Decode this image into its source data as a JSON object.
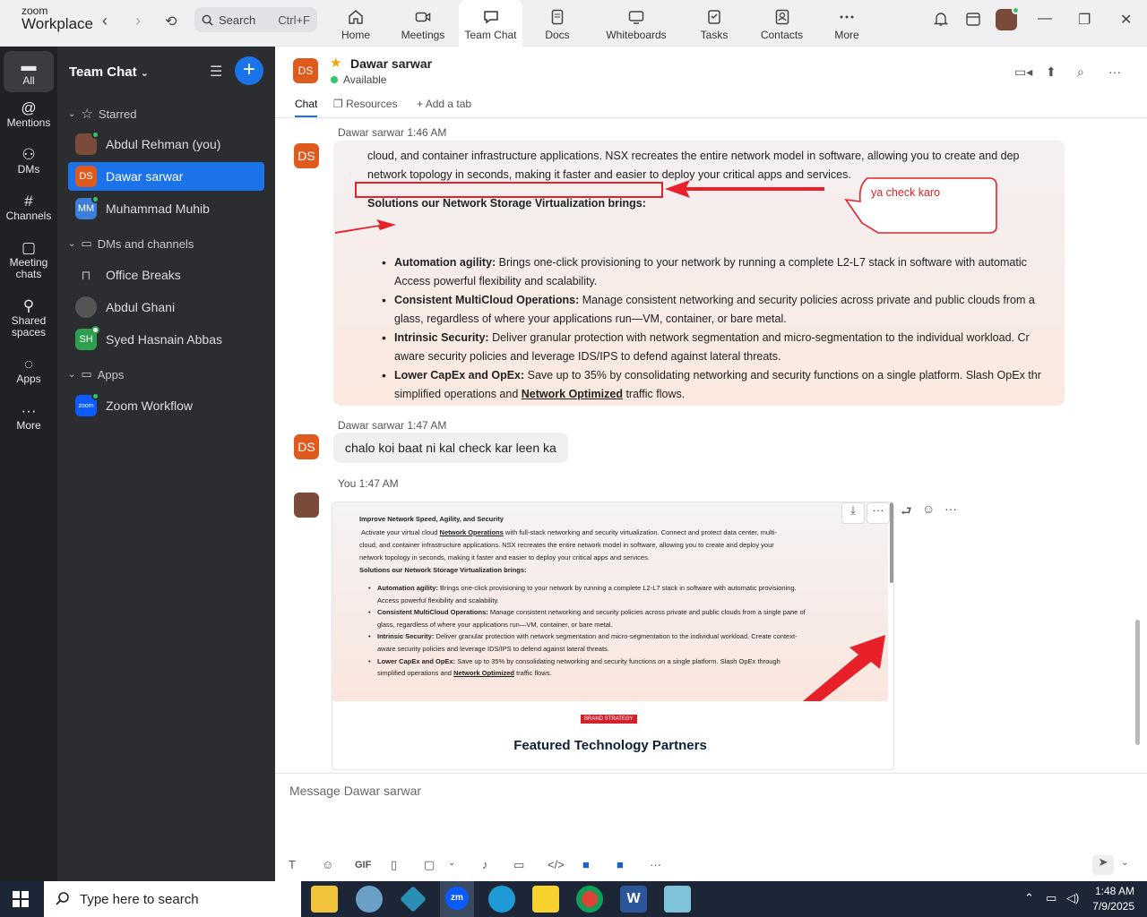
{
  "app": {
    "logo_top": "zoom",
    "logo_bottom": "Workplace"
  },
  "search": {
    "label": "Search",
    "shortcut": "Ctrl+F"
  },
  "top_tabs": [
    {
      "label": "Home",
      "icon": "home-icon"
    },
    {
      "label": "Meetings",
      "icon": "video-icon"
    },
    {
      "label": "Team Chat",
      "icon": "chat-icon"
    },
    {
      "label": "Docs",
      "icon": "doc-icon"
    },
    {
      "label": "Whiteboards",
      "icon": "whiteboard-icon"
    },
    {
      "label": "Tasks",
      "icon": "tasks-icon"
    },
    {
      "label": "Contacts",
      "icon": "contacts-icon"
    },
    {
      "label": "More",
      "icon": "more-icon"
    }
  ],
  "sidenav": [
    {
      "label": "All"
    },
    {
      "label": "Mentions"
    },
    {
      "label": "DMs"
    },
    {
      "label": "Channels"
    },
    {
      "label": "Meeting chats"
    },
    {
      "label": "Shared spaces"
    },
    {
      "label": "Apps"
    },
    {
      "label": "More"
    }
  ],
  "panel": {
    "title": "Team Chat",
    "starred_label": "Starred",
    "starred": [
      {
        "name": "Abdul Rehman (you)",
        "initials": "",
        "color": "#7a4a3a"
      },
      {
        "name": "Dawar sarwar",
        "initials": "DS",
        "color": "#e05a1e"
      },
      {
        "name": "Muhammad Muhib",
        "initials": "MM",
        "color": "#3b7dd8"
      }
    ],
    "dms_label": "DMs and channels",
    "dms": [
      {
        "name": "Office Breaks",
        "initials": "",
        "color": ""
      },
      {
        "name": "Abdul Ghani",
        "initials": "",
        "color": "#555"
      },
      {
        "name": "Syed Hasnain Abbas",
        "initials": "SH",
        "color": "#2e9e4f"
      }
    ],
    "apps_label": "Apps",
    "apps": [
      {
        "name": "Zoom Workflow",
        "initials": "zoom",
        "color": "#0b5cff"
      }
    ]
  },
  "chat": {
    "contact_name": "Dawar sarwar",
    "contact_initials": "DS",
    "status": "Available",
    "tabs": [
      "Chat",
      "Resources",
      "Add a tab"
    ]
  },
  "messages": [
    {
      "sender": "Dawar sarwar",
      "time": "1:46 AM"
    },
    {
      "sender": "Dawar sarwar",
      "time": "1:47 AM",
      "text": "chalo koi baat ni kal check kar leen ka"
    },
    {
      "sender": "You",
      "time": "1:47 AM"
    }
  ],
  "image1": {
    "line1": "cloud, and container infrastructure applications. NSX recreates the entire network model in software, allowing you to create and dep",
    "line2": "network topology in seconds, making it faster and easier to deploy your critical apps and services.",
    "heading": "Solutions our Network Storage Virtualization brings:",
    "callout": "ya check karo",
    "bullets": [
      {
        "bold": "Automation agility:",
        "text": " Brings one-click provisioning to your network by running a complete L2-L7 stack in software with automatic",
        "cont": "Access powerful flexibility and scalability."
      },
      {
        "bold": "Consistent MultiCloud Operations:",
        "text": " Manage consistent networking and security policies across private and public clouds from a",
        "cont": "glass, regardless of where your applications run—VM, container, or bare metal."
      },
      {
        "bold": "Intrinsic Security:",
        "text": " Deliver granular protection with network segmentation and micro-segmentation to the individual workload. Cr",
        "cont": "aware security policies and leverage IDS/IPS to defend against lateral threats."
      },
      {
        "bold": "Lower CapEx and OpEx:",
        "text": " Save up to 35% by consolidating networking and security functions on a single platform. Slash OpEx thr",
        "cont_pre": "simplified operations and ",
        "cont_link": "Network Optimized",
        "cont_post": " traffic flows."
      }
    ]
  },
  "image2": {
    "title": "Improve Network Speed, Agility, and Security",
    "p1_pre": "Activate your virtual cloud ",
    "p1_link": "Network Operations",
    "p1_post": " with full-stack networking and security virtualization. Connect and protect data center, multi-",
    "p2": "cloud, and container infrastructure applications. NSX recreates the entire network model in software, allowing you to create and deploy your",
    "p3": "network topology in seconds, making it faster and easier to deploy your critical apps and services.",
    "heading": "Solutions our Network Storage Virtualization brings:",
    "bullets": [
      {
        "bold": "Automation agility:",
        "text": " Brings one-click provisioning to your network by running a complete L2-L7 stack in software with automatic provisioning.",
        "cont": "Access powerful flexibility and scalability."
      },
      {
        "bold": "Consistent MultiCloud Operations:",
        "text": " Manage consistent networking and security policies across private and public clouds from a single pane of",
        "cont": "glass, regardless of where your applications run—VM, container, or bare metal."
      },
      {
        "bold": "Intrinsic Security:",
        "text": " Deliver granular protection with network segmentation and micro-segmentation to the individual workload. Create context-",
        "cont": "aware security policies and leverage IDS/IPS to defend against lateral threats."
      },
      {
        "bold": "Lower CapEx and OpEx:",
        "text": " Save up to 35% by consolidating networking and security functions on a single platform. Slash OpEx through",
        "cont_pre": "simplified operations and ",
        "cont_link": "Network Optimized",
        "cont_post": " traffic flows."
      }
    ],
    "badge": "BRAND STRATEGY",
    "featured": "Featured Technology Partners"
  },
  "composer": {
    "placeholder": "Message Dawar sarwar",
    "gif": "GIF"
  },
  "taskbar": {
    "search": "Type here to search",
    "time": "1:48 AM",
    "date": "7/9/2025"
  }
}
